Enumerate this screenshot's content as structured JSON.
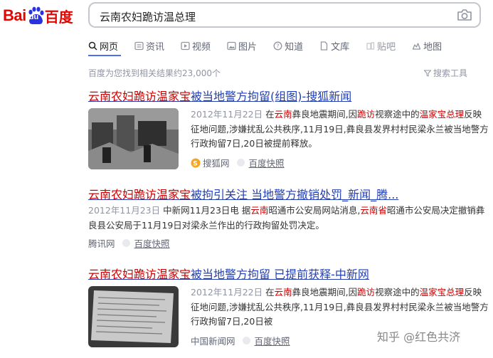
{
  "logo": {
    "bai": "Bai",
    "du": "du",
    "cn": "百度"
  },
  "search": {
    "query": "云南农妇跪访温总理"
  },
  "tabs": [
    {
      "label": "网页",
      "icon": "search-icon"
    },
    {
      "label": "资讯",
      "icon": "news-icon"
    },
    {
      "label": "视频",
      "icon": "video-icon"
    },
    {
      "label": "图片",
      "icon": "image-icon"
    },
    {
      "label": "知道",
      "icon": "question-icon"
    },
    {
      "label": "文库",
      "icon": "document-icon"
    },
    {
      "label": "贴吧",
      "icon": "tieba-icon"
    },
    {
      "label": "地图",
      "icon": "map-icon"
    }
  ],
  "result_count": "百度为您找到相关结果约23,000个",
  "search_tools": "搜索工具",
  "results": [
    {
      "title_hl": "云南农妇跪访温家宝",
      "title_rest": "被当地警方拘留(组图)-搜狐新闻",
      "date": "2012年11月22日",
      "abs_parts": [
        "在",
        "云南",
        "彝良地震期间,因",
        "跪访",
        "视察途中的",
        "温家宝总理",
        "反映征地问题,涉嫌扰乱公共秩序,11月19日,彝良县发界村村民梁永兰被当地警方行政拘留7日,20日被提前释放。"
      ],
      "source": "搜狐网",
      "snapshot": "百度快照"
    },
    {
      "title_hl": "云南农妇跪访温家宝",
      "title_rest": "被拘引关注 当地警方撤销处罚_新闻_腾...",
      "date": "2012年11月23日",
      "abs_parts": [
        "中新网11月23日电 据",
        "云南",
        "昭通市公安局网站消息,",
        "云南省",
        "昭通市公安局决定撤销彝良县公安局于11月19日对梁永兰作出的行政拘留处罚决定。"
      ],
      "source": "腾讯网",
      "snapshot": "百度快照"
    },
    {
      "title_hl": "云南农妇跪访温家宝",
      "title_rest": "被当地警方拘留 已提前获释-中新网",
      "date": "2012年11月22日",
      "abs_parts": [
        "在",
        "云南",
        "彝良地震期间,因",
        "跪访",
        "视察途中的",
        "温家宝总理",
        "反映征地问题,涉嫌扰乱公共秩序,11月19日,彝良县发界村村民梁永兰被当地警方行政拘留7日,20日被"
      ],
      "source": "中国新闻网",
      "snapshot": "百度快照"
    }
  ],
  "watermark": "知乎 @红色共济",
  "colors": {
    "brand_red": "#e10601",
    "link_blue": "#2440b3",
    "highlight": "#cc0000",
    "tab_accent": "#4e6ef2"
  }
}
